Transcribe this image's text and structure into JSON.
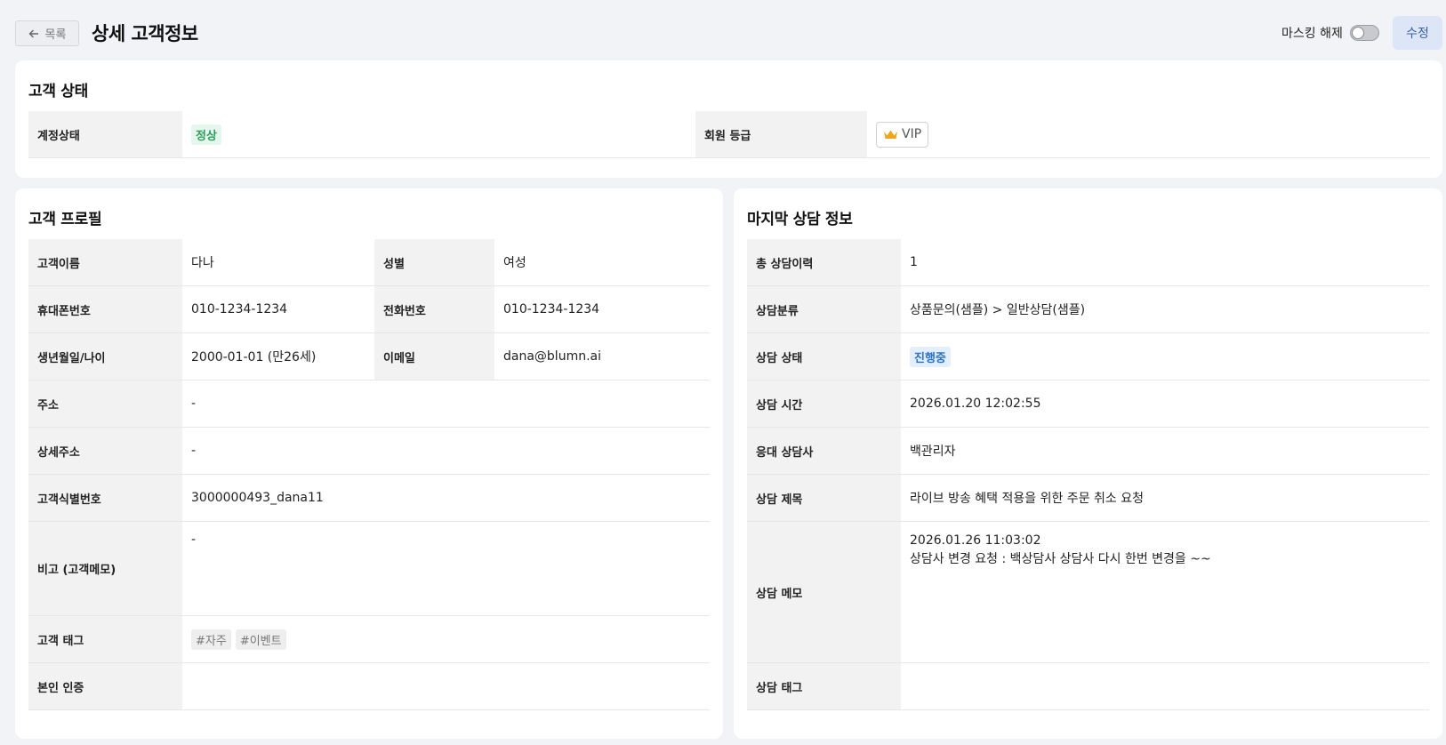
{
  "header": {
    "back_label": "목록",
    "title": "상세 고객정보",
    "masking_label": "마스킹 해제",
    "masking_on": false,
    "edit_label": "수정"
  },
  "status": {
    "title": "고객 상태",
    "account_status_label": "계정상태",
    "account_status_value": "정상",
    "grade_label": "회원 등급",
    "grade_value": "VIP"
  },
  "profile": {
    "title": "고객 프로필",
    "name_label": "고객이름",
    "name_value": "다나",
    "gender_label": "성별",
    "gender_value": "여성",
    "mobile_label": "휴대폰번호",
    "mobile_value": "010-1234-1234",
    "phone_label": "전화번호",
    "phone_value": "010-1234-1234",
    "birth_label": "생년월일/나이",
    "birth_value": "2000-01-01 (만26세)",
    "email_label": "이메일",
    "email_value": "dana@blumn.ai",
    "address_label": "주소",
    "address_value": "-",
    "detail_address_label": "상세주소",
    "detail_address_value": "-",
    "customer_id_label": "고객식별번호",
    "customer_id_value": "3000000493_dana11",
    "memo_label": "비고 (고객메모)",
    "memo_value": "-",
    "tags_label": "고객 태그",
    "tags": [
      "#자주",
      "#이벤트"
    ],
    "verify_label": "본인 인증",
    "verify_value": ""
  },
  "consult": {
    "title": "마지막 상담 정보",
    "total_label": "총 상담이력",
    "total_value": "1",
    "category_label": "상담분류",
    "category_value": "상품문의(샘플) > 일반상담(샘플)",
    "state_label": "상담 상태",
    "state_value": "진행중",
    "time_label": "상담 시간",
    "time_value": "2026.01.20 12:02:55",
    "agent_label": "응대 상담사",
    "agent_value": "백관리자",
    "subject_label": "상담 제목",
    "subject_value": "라이브 방송 혜택 적용을 위한 주문 취소 요청",
    "memo_label": "상담 메모",
    "memo_line1": "2026.01.26 11:03:02",
    "memo_line2": "상담사 변경 요청 : 백상담사 상담사 다시 한번 변경을 ~~",
    "tags_label": "상담 태그",
    "tags_value": ""
  },
  "colors": {
    "background": "#f2f3f6",
    "label_cell": "#f2f2f2",
    "status_green": "#2e9c5c",
    "status_blue": "#2b73c4",
    "edit_button": "#dde6f7"
  }
}
